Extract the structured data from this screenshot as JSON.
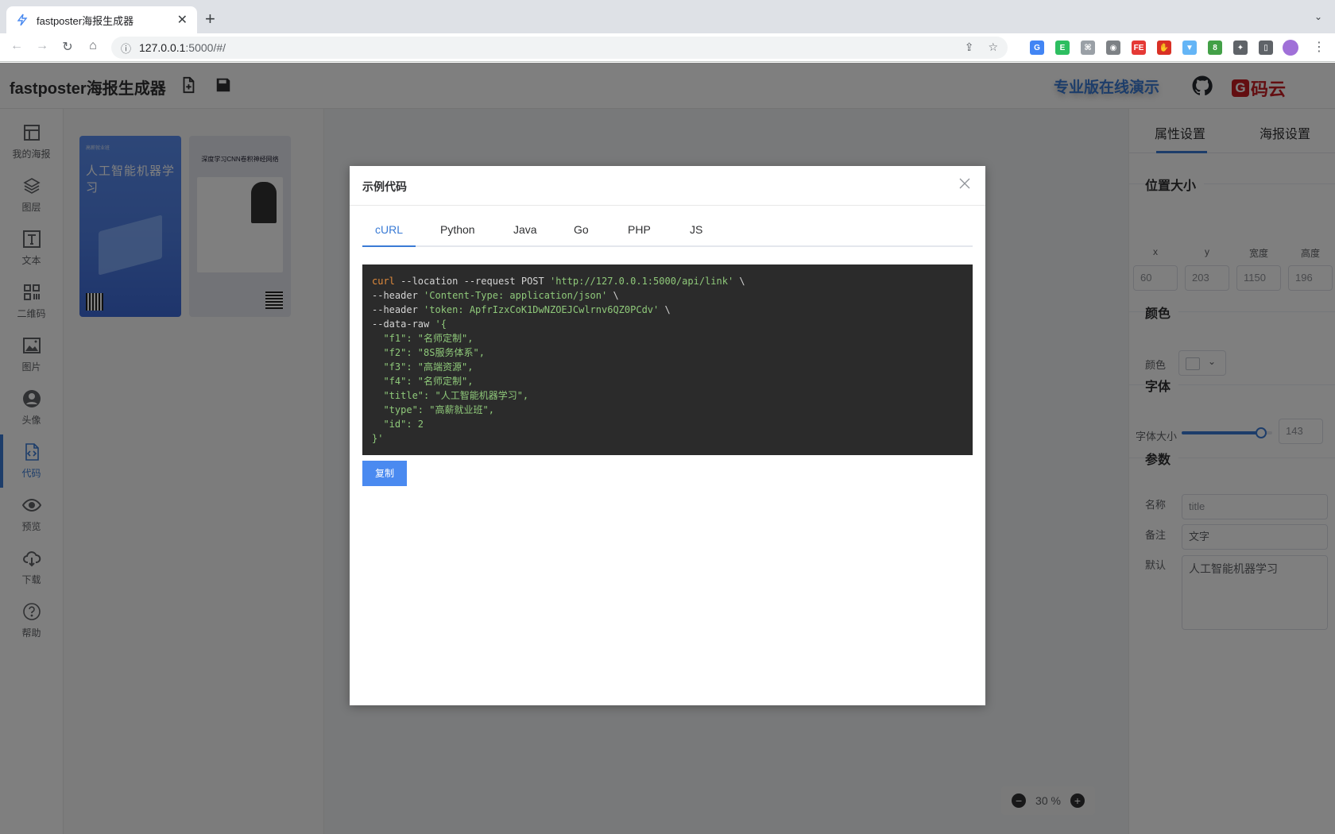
{
  "browser": {
    "tab_title": "fastposter海报生成器",
    "url_host": "127.0.0.1",
    "url_rest": ":5000/#/",
    "extensions": [
      {
        "name": "google-translate-icon",
        "color": "#4285f4",
        "glyph": "G"
      },
      {
        "name": "evernote-icon",
        "color": "#2dbe60",
        "glyph": "E"
      },
      {
        "name": "extension-gray-icon",
        "color": "#9aa0a6",
        "glyph": "⌘"
      },
      {
        "name": "camera-icon",
        "color": "#7d8185",
        "glyph": "◉"
      },
      {
        "name": "fe-helper-icon",
        "color": "#e53935",
        "glyph": "FE"
      },
      {
        "name": "adblock-icon",
        "color": "#d93025",
        "glyph": "✋"
      },
      {
        "name": "filter-icon",
        "color": "#64b5f6",
        "glyph": "▼"
      },
      {
        "name": "search-extension-icon",
        "color": "#43a047",
        "glyph": "8"
      },
      {
        "name": "puzzle-icon",
        "color": "#5f6368",
        "glyph": "✦"
      },
      {
        "name": "side-panel-icon",
        "color": "#5f6368",
        "glyph": "▯"
      }
    ]
  },
  "header": {
    "title": "fastposter海报生成器",
    "pro_demo_label": "专业版在线演示",
    "gitee_label": "码云",
    "gitee_glyph": "G"
  },
  "sidebar": {
    "items": [
      {
        "label": "我的海报",
        "icon": "layout-icon"
      },
      {
        "label": "图层",
        "icon": "layers-icon"
      },
      {
        "label": "文本",
        "icon": "text-icon"
      },
      {
        "label": "二维码",
        "icon": "qrcode-icon"
      },
      {
        "label": "图片",
        "icon": "image-icon"
      },
      {
        "label": "头像",
        "icon": "avatar-icon"
      },
      {
        "label": "代码",
        "icon": "code-file-icon",
        "active": true
      },
      {
        "label": "预览",
        "icon": "eye-icon"
      },
      {
        "label": "下载",
        "icon": "cloud-download-icon"
      },
      {
        "label": "帮助",
        "icon": "help-icon"
      }
    ]
  },
  "posters": [
    {
      "title": "人工智能机器学习"
    },
    {
      "title": "深度学习CNN卷积神经网络"
    }
  ],
  "canvas": {
    "zoom_value": "30 %"
  },
  "right_panel": {
    "tabs": [
      "属性设置",
      "海报设置"
    ],
    "active_tab": 0,
    "position_size": {
      "title": "位置大小",
      "labels": [
        "x",
        "y",
        "宽度",
        "高度"
      ],
      "values": [
        "60",
        "203",
        "1150",
        "196"
      ]
    },
    "color": {
      "title": "颜色",
      "label": "颜色"
    },
    "font": {
      "title": "字体",
      "size_label": "字体大小",
      "size_value": "143",
      "slider_fraction": 0.88
    },
    "params": {
      "title": "参数",
      "name_label": "名称",
      "name_value": "title",
      "note_label": "备注",
      "note_value": "文字",
      "default_label": "默认",
      "default_value": "人工智能机器学习"
    }
  },
  "modal": {
    "title": "示例代码",
    "tabs": [
      "cURL",
      "Python",
      "Java",
      "Go",
      "PHP",
      "JS"
    ],
    "active_tab": 0,
    "code_lines": [
      [
        {
          "t": "curl",
          "c": "kw"
        },
        {
          "t": " --location --request POST ",
          "c": "plain"
        },
        {
          "t": "'http://127.0.0.1:5000/api/link'",
          "c": "str"
        },
        {
          "t": " \\",
          "c": "plain"
        }
      ],
      [
        {
          "t": "--header ",
          "c": "plain"
        },
        {
          "t": "'Content-Type: application/json'",
          "c": "str"
        },
        {
          "t": " \\",
          "c": "plain"
        }
      ],
      [
        {
          "t": "--header ",
          "c": "plain"
        },
        {
          "t": "'token: ApfrIzxCoK1DwNZOEJCwlrnv6QZ0PCdv'",
          "c": "str"
        },
        {
          "t": " \\",
          "c": "plain"
        }
      ],
      [
        {
          "t": "--data-raw ",
          "c": "plain"
        },
        {
          "t": "'{",
          "c": "str"
        }
      ],
      [
        {
          "t": "  \"f1\": \"名师定制\",",
          "c": "str"
        }
      ],
      [
        {
          "t": "  \"f2\": \"8S服务体系\",",
          "c": "str"
        }
      ],
      [
        {
          "t": "  \"f3\": \"高端资源\",",
          "c": "str"
        }
      ],
      [
        {
          "t": "  \"f4\": \"名师定制\",",
          "c": "str"
        }
      ],
      [
        {
          "t": "  \"title\": \"人工智能机器学习\",",
          "c": "str"
        }
      ],
      [
        {
          "t": "  \"type\": \"高薪就业班\",",
          "c": "str"
        }
      ],
      [
        {
          "t": "  \"id\": 2",
          "c": "str"
        }
      ],
      [
        {
          "t": "}'",
          "c": "str"
        }
      ]
    ],
    "copy_label": "复制"
  }
}
